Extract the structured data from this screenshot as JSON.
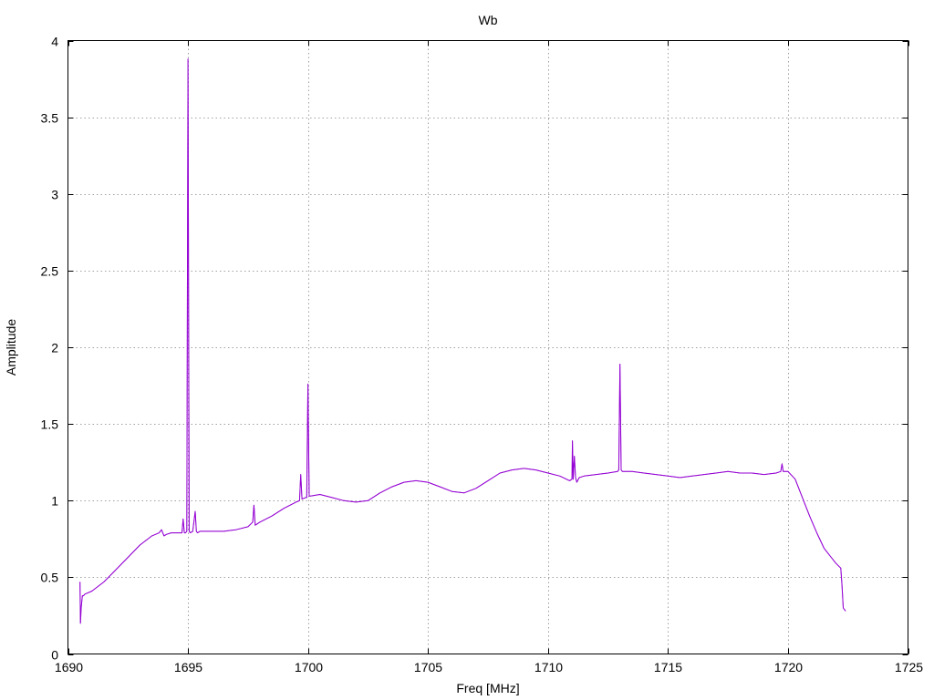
{
  "chart_data": {
    "type": "line",
    "title": "Wb",
    "xlabel": "Freq [MHz]",
    "ylabel": "Amplitude",
    "xlim": [
      1690,
      1725
    ],
    "ylim": [
      0,
      4
    ],
    "xticks": [
      1690,
      1695,
      1700,
      1705,
      1710,
      1715,
      1720,
      1725
    ],
    "xtick_labels": [
      "1690",
      "1695",
      "1700",
      "1705",
      "1710",
      "1715",
      "1720",
      "1725"
    ],
    "yticks": [
      0,
      0.5,
      1,
      1.5,
      2,
      2.5,
      3,
      3.5,
      4
    ],
    "ytick_labels": [
      "0",
      "0.5",
      "1",
      "1.5",
      "2",
      "2.5",
      "3",
      "3.5",
      "4"
    ],
    "grid": true,
    "legend": "none",
    "color": "#9400d3",
    "series": [
      {
        "x": [
          1690.5,
          1690.52,
          1690.55,
          1690.6,
          1690.65,
          1690.7,
          1691,
          1691.5,
          1692,
          1692.5,
          1693,
          1693.5,
          1693.8,
          1693.9,
          1694,
          1694.1,
          1694.3,
          1694.5,
          1694.75,
          1694.8,
          1694.85,
          1694.9,
          1694.95,
          1695,
          1695.05,
          1695.1,
          1695.2,
          1695.3,
          1695.35,
          1695.4,
          1695.5,
          1696,
          1696.5,
          1697,
          1697.5,
          1697.7,
          1697.75,
          1697.8,
          1698,
          1698.5,
          1699,
          1699.5,
          1699.65,
          1699.7,
          1699.75,
          1699.9,
          1699.95,
          1700,
          1700.05,
          1700.1,
          1700.5,
          1701,
          1701.5,
          1702,
          1702.5,
          1703,
          1703.5,
          1704,
          1704.5,
          1705,
          1705.5,
          1706,
          1706.5,
          1707,
          1707.5,
          1708,
          1708.5,
          1709,
          1709.5,
          1710,
          1710.5,
          1710.9,
          1711,
          1711.02,
          1711.05,
          1711.1,
          1711.15,
          1711.2,
          1711.3,
          1711.5,
          1712,
          1712.5,
          1712.9,
          1712.95,
          1713,
          1713.05,
          1713.1,
          1713.5,
          1714,
          1714.5,
          1715,
          1715.5,
          1716,
          1716.5,
          1717,
          1717.5,
          1718,
          1718.5,
          1719,
          1719.5,
          1719.7,
          1719.75,
          1719.8,
          1720,
          1720.3,
          1720.6,
          1720.9,
          1721.2,
          1721.5,
          1721.8,
          1722,
          1722.2,
          1722.25,
          1722.3,
          1722.4
        ],
        "y": [
          0.47,
          0.2,
          0.3,
          0.38,
          0.38,
          0.39,
          0.41,
          0.47,
          0.55,
          0.63,
          0.71,
          0.77,
          0.79,
          0.81,
          0.77,
          0.78,
          0.79,
          0.79,
          0.79,
          0.88,
          0.79,
          0.79,
          0.8,
          3.88,
          0.8,
          0.79,
          0.8,
          0.93,
          0.8,
          0.79,
          0.8,
          0.8,
          0.8,
          0.81,
          0.83,
          0.86,
          0.97,
          0.84,
          0.86,
          0.9,
          0.95,
          0.99,
          1.0,
          1.17,
          1.01,
          1.02,
          1.02,
          1.76,
          1.03,
          1.03,
          1.04,
          1.02,
          1.0,
          0.99,
          1.0,
          1.05,
          1.09,
          1.12,
          1.13,
          1.12,
          1.09,
          1.06,
          1.05,
          1.08,
          1.13,
          1.18,
          1.2,
          1.21,
          1.2,
          1.18,
          1.16,
          1.13,
          1.14,
          1.39,
          1.14,
          1.29,
          1.15,
          1.12,
          1.15,
          1.16,
          1.17,
          1.18,
          1.19,
          1.2,
          1.89,
          1.2,
          1.19,
          1.19,
          1.18,
          1.17,
          1.16,
          1.15,
          1.16,
          1.17,
          1.18,
          1.19,
          1.18,
          1.18,
          1.17,
          1.18,
          1.19,
          1.24,
          1.19,
          1.19,
          1.14,
          1.02,
          0.9,
          0.79,
          0.69,
          0.63,
          0.59,
          0.56,
          0.45,
          0.3,
          0.28
        ]
      }
    ]
  }
}
